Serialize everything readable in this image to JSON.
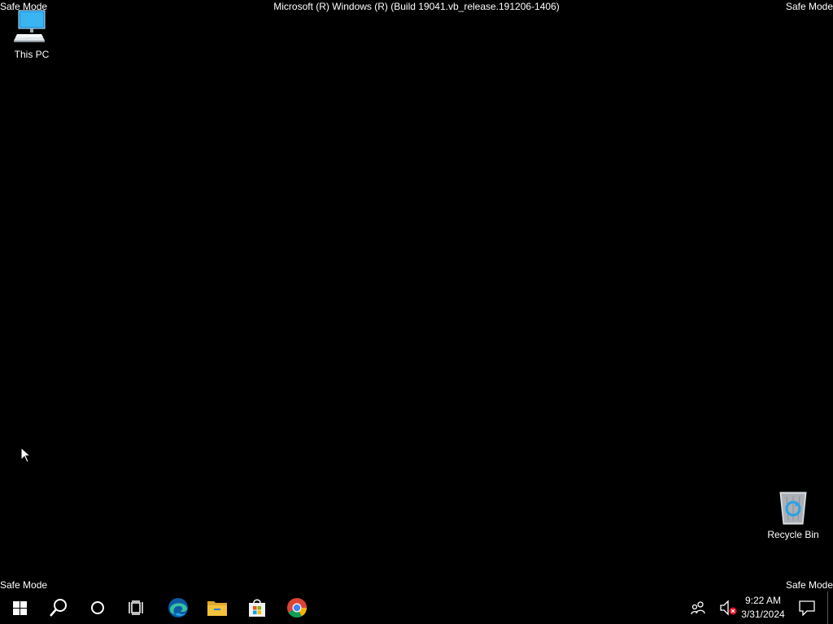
{
  "overlay": {
    "safe_mode_label": "Safe Mode",
    "build_string": "Microsoft (R) Windows (R) (Build 19041.vb_release.191206-1406)"
  },
  "desktop_icons": {
    "this_pc": {
      "label": "This PC",
      "icon": "computer-icon"
    },
    "recycle_bin": {
      "label": "Recycle Bin",
      "icon": "recycle-bin-icon"
    }
  },
  "taskbar": {
    "pinned": [
      {
        "name": "start-button",
        "icon": "windows-logo-icon"
      },
      {
        "name": "search-button",
        "icon": "search-icon"
      },
      {
        "name": "cortana-button",
        "icon": "cortana-circle-icon"
      },
      {
        "name": "task-view-button",
        "icon": "task-view-icon"
      },
      {
        "name": "edge-button",
        "icon": "edge-icon"
      },
      {
        "name": "file-explorer-button",
        "icon": "folder-icon"
      },
      {
        "name": "store-button",
        "icon": "store-bag-icon"
      },
      {
        "name": "chrome-button",
        "icon": "chrome-icon"
      }
    ],
    "tray": {
      "people_icon": "people-icon",
      "volume_icon": "volume-muted-icon",
      "time": "9:22 AM",
      "date": "3/31/2024",
      "notification_icon": "action-center-icon"
    }
  },
  "colors": {
    "background": "#000000",
    "text": "#ffffff",
    "windows_blue": "#00a4ef",
    "edge_teal": "#36c3a0",
    "folder_yellow": "#f3c13a",
    "mute_red": "#e81123"
  }
}
